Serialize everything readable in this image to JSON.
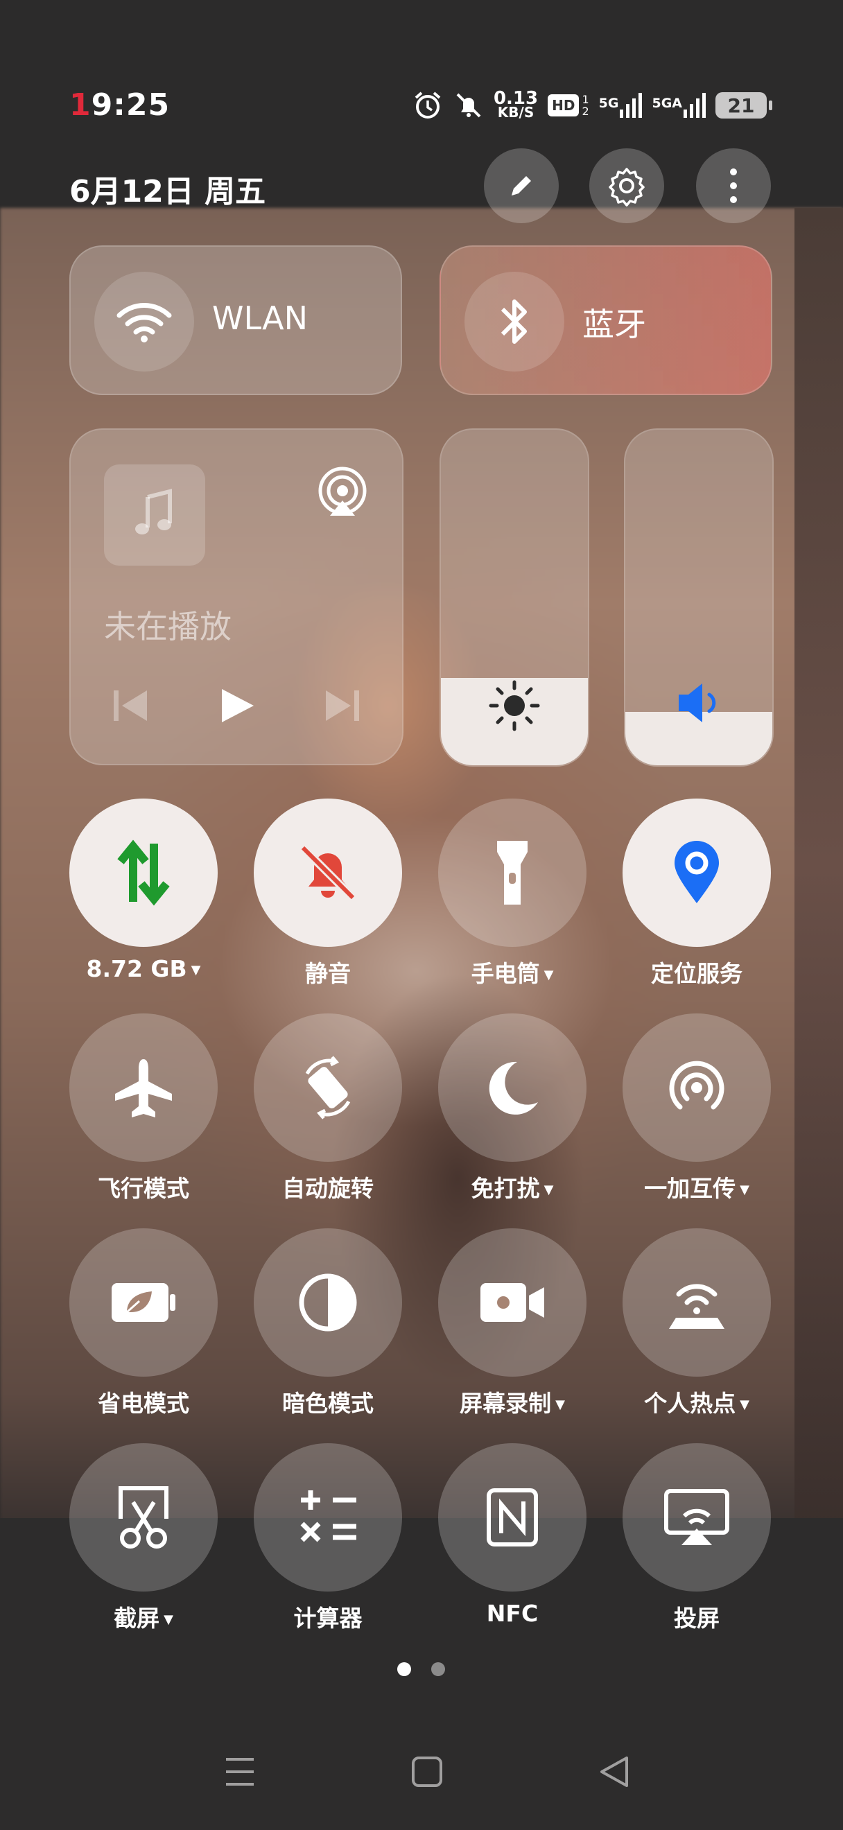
{
  "status_bar": {
    "time_first_digit": "1",
    "time_rest": "9:25",
    "net_speed_value": "0.13",
    "net_speed_unit": "KB/S",
    "hd_label": "HD",
    "hd_sub_top": "1",
    "hd_sub_bottom": "2",
    "net1_label": "5G",
    "net2_label": "5GA",
    "battery_level": "21"
  },
  "header": {
    "date": "6月12日 周五"
  },
  "connectivity": {
    "wlan_label": "WLAN",
    "bluetooth_label": "蓝牙"
  },
  "media": {
    "status": "未在播放"
  },
  "sliders": {
    "brightness_level": 0.26,
    "volume_level": 0.16
  },
  "toggles": {
    "data_usage": "8.72 GB",
    "silent": "静音",
    "flashlight": "手电筒",
    "location": "定位服务",
    "airplane": "飞行模式",
    "auto_rotate": "自动旋转",
    "dnd": "免打扰",
    "oneplus_share": "一加互传",
    "battery_saver": "省电模式",
    "dark_mode": "暗色模式",
    "screen_record": "屏幕录制",
    "hotspot": "个人热点",
    "screenshot": "截屏",
    "calculator": "计算器",
    "nfc": "NFC",
    "cast": "投屏"
  },
  "colors": {
    "data_icon": "#1f9a2e",
    "silent_icon": "#e1473a",
    "location_icon": "#1b6ef5",
    "volume_icon": "#1b6ef5",
    "time_accent": "#e0293a"
  },
  "pager": {
    "current_page": 1,
    "total_pages": 2
  }
}
